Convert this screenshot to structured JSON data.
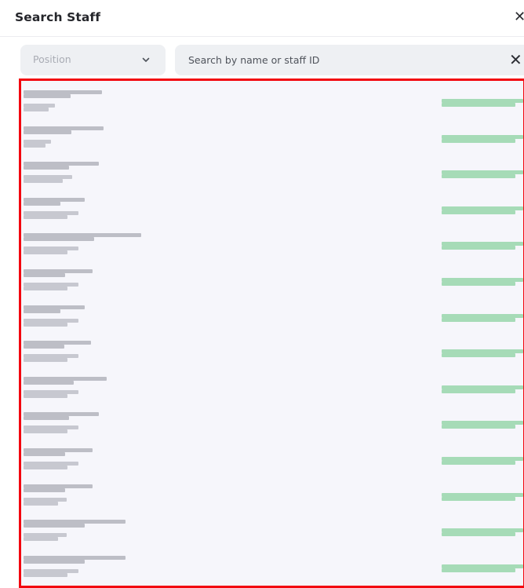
{
  "dialog": {
    "title": "Search Staff",
    "close_icon": "close-icon"
  },
  "filters": {
    "position_placeholder": "Position",
    "position_icon": "chevron-down-icon",
    "search_placeholder": "Search by name or staff ID",
    "search_value": "",
    "clear_icon": "close-icon"
  },
  "results": {
    "highlight_color": "#f2070f",
    "status_color": "#8fd3a4",
    "note": "",
    "rows": [
      {
        "name": "",
        "staff_id": "",
        "status": ""
      },
      {
        "name": "",
        "staff_id": "",
        "status": ""
      },
      {
        "name": "",
        "staff_id": "",
        "status": ""
      },
      {
        "name": "",
        "staff_id": "",
        "status": ""
      },
      {
        "name": "",
        "staff_id": "",
        "status": ""
      },
      {
        "name": "",
        "staff_id": "",
        "status": ""
      },
      {
        "name": "",
        "staff_id": "",
        "status": ""
      },
      {
        "name": "",
        "staff_id": "",
        "status": ""
      },
      {
        "name": "",
        "staff_id": "",
        "status": ""
      },
      {
        "name": "",
        "staff_id": "",
        "status": ""
      },
      {
        "name": "",
        "staff_id": "",
        "status": ""
      },
      {
        "name": "",
        "staff_id": "",
        "status": ""
      },
      {
        "name": "",
        "staff_id": "",
        "status": ""
      },
      {
        "name": "",
        "staff_id": "",
        "status": ""
      }
    ]
  }
}
